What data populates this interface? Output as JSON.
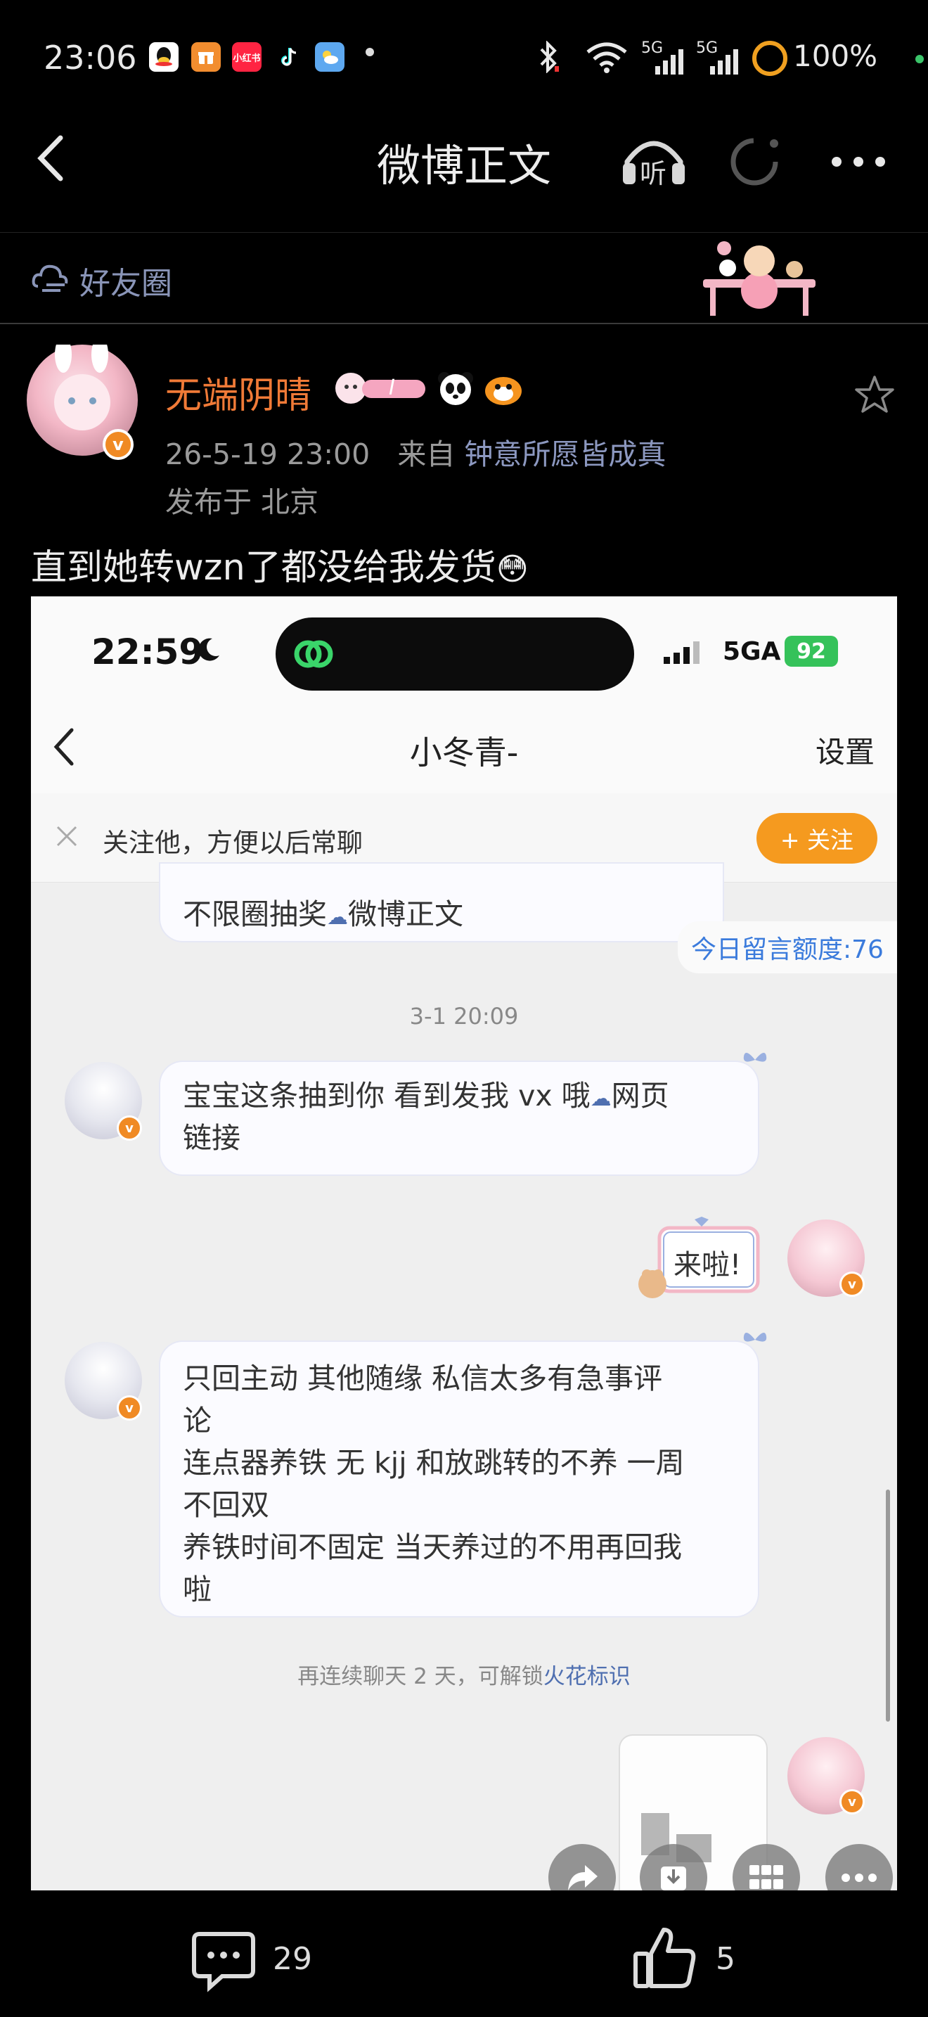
{
  "status_bar": {
    "time": "23:06",
    "app_icons": [
      "qq-icon",
      "gift-app-icon",
      "xiaohongshu-icon",
      "tiktok-icon",
      "weather-icon"
    ],
    "xhs_label": "小红书",
    "signal_1": "5G",
    "signal_2": "5G",
    "battery": "100%"
  },
  "nav": {
    "title": "微博正文",
    "listen_label": "听"
  },
  "circle_bar": {
    "label": "好友圈"
  },
  "post": {
    "username": "无端阴晴",
    "badge_text": "I",
    "time": "26-5-19 23:00",
    "from_prefix": "来自",
    "source": "钟意所愿皆成真",
    "location": "发布于 北京",
    "text": "直到她转wzn了都没给我发货",
    "emoji": "😳"
  },
  "screenshot": {
    "status_time": "22:59",
    "network": "5GA",
    "battery": "92",
    "chat_title": "小冬青-",
    "settings": "设置",
    "follow_prompt": "关注他，方便以后常聊",
    "follow_button": "+ 关注",
    "msg_partial": "不限圈抽奖",
    "msg_partial_link": "微博正文",
    "quota": "今日留言额度:76",
    "timestamp": "3-1 20:09",
    "msg1_a": "宝宝这条抽到你  看到发我 vx 哦",
    "msg1_link": "网页",
    "msg1_b": "链接",
    "sticker_text": "来啦!",
    "msg2_l1": "只回主动 其他随缘 私信太多有急事评",
    "msg2_l2": "论",
    "msg2_l3": "连点器养铁 无 kjj 和放跳转的不养 一周",
    "msg2_l4": "不回双",
    "msg2_l5": "养铁时间不固定 当天养过的不用再回我",
    "msg2_l6": "啦",
    "streak_prefix": "再连续聊天 2 天，可解锁",
    "streak_link": "火花标识"
  },
  "bottom": {
    "comments": "29",
    "likes": "5"
  },
  "colors": {
    "username": "#f07a37",
    "follow_button": "#f59a1f",
    "link": "#4f6fb0",
    "quota": "#3b7bdc"
  }
}
